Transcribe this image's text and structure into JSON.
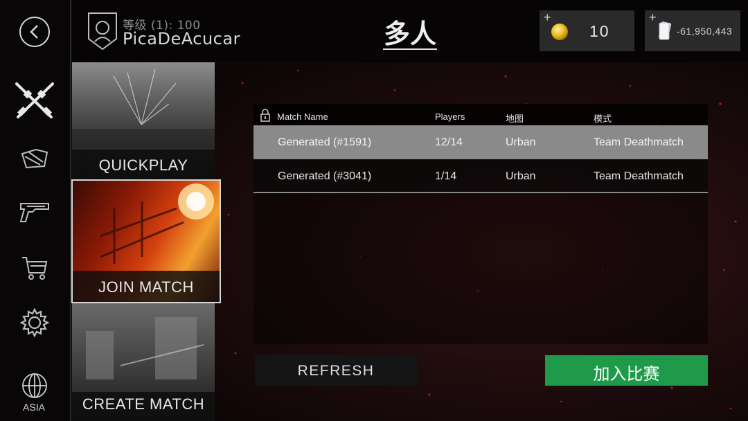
{
  "header": {
    "title": "多人",
    "player": {
      "level_text": "等级 (1): 100",
      "name": "PicaDeAcucar"
    },
    "coins": {
      "plus": "+",
      "value": "10"
    },
    "cash": {
      "plus": "+",
      "value": "-61,950,443"
    }
  },
  "sidebar": {
    "items": [
      {
        "icon": "back-icon"
      },
      {
        "icon": "crossed-rifles-icon",
        "active": true
      },
      {
        "icon": "skin-icon"
      },
      {
        "icon": "pistol-icon"
      },
      {
        "icon": "shopping-cart-icon"
      },
      {
        "icon": "gear-icon"
      },
      {
        "icon": "globe-icon",
        "label": "ASIA"
      }
    ]
  },
  "modes": {
    "quickplay": "QUICKPLAY",
    "join_match": "JOIN MATCH",
    "create_match": "CREATE MATCH"
  },
  "table": {
    "columns": [
      "Match Name",
      "Players",
      "地图",
      "模式"
    ],
    "rows": [
      {
        "name": "Generated (#1591)",
        "players": "12/14",
        "map": "Urban",
        "mode": "Team Deathmatch",
        "selected": true
      },
      {
        "name": "Generated (#3041)",
        "players": "1/14",
        "map": "Urban",
        "mode": "Team Deathmatch",
        "selected": false
      }
    ]
  },
  "actions": {
    "refresh": "REFRESH",
    "join": "加入比赛"
  },
  "colors": {
    "join_green": "#1e9a4a",
    "selected_row": "#8a8a8a",
    "background_red": "#3a1517"
  }
}
